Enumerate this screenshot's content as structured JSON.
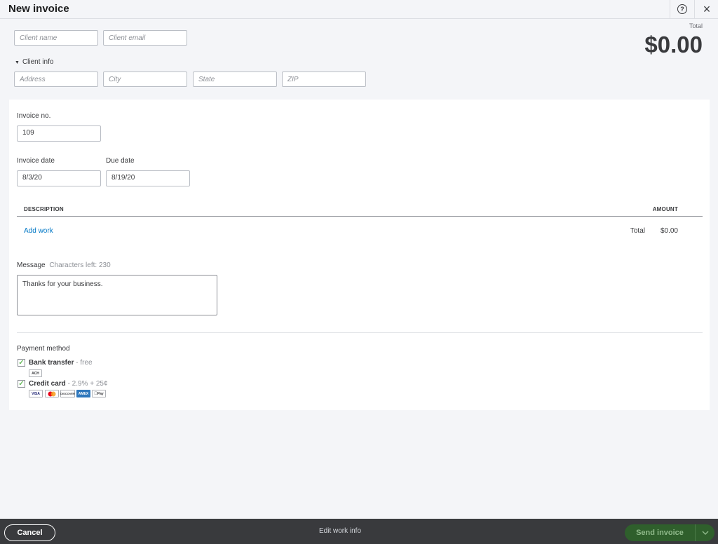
{
  "header": {
    "title": "New invoice",
    "help_icon": "help-circle-icon",
    "close_icon": "close-icon",
    "help_glyph": "?",
    "close_glyph": "×"
  },
  "client": {
    "name_placeholder": "Client name",
    "email_placeholder": "Client email",
    "info_toggle": "Client info",
    "address_placeholder": "Address",
    "city_placeholder": "City",
    "state_placeholder": "State",
    "zip_placeholder": "ZIP"
  },
  "summary": {
    "total_label": "Total",
    "total_amount": "$0.00"
  },
  "invoice": {
    "number_label": "Invoice no.",
    "number_value": "109",
    "date_label": "Invoice date",
    "date_value": "8/3/20",
    "due_label": "Due date",
    "due_value": "8/19/20"
  },
  "lines": {
    "description_header": "DESCRIPTION",
    "amount_header": "AMOUNT",
    "add_work": "Add work",
    "total_label": "Total",
    "total_value": "$0.00"
  },
  "message": {
    "label": "Message",
    "chars_left": "Characters left: 230",
    "value": "Thanks for your business."
  },
  "payment": {
    "section_label": "Payment method",
    "bank": {
      "label": "Bank transfer",
      "fee": " - free",
      "checked": true,
      "badge": "ACH"
    },
    "card": {
      "label": "Credit card",
      "fee": " - 2.9% + 25¢",
      "checked": true,
      "badges": [
        "VISA",
        "MC",
        "DISCOVER",
        "AMEX",
        "Pay"
      ]
    }
  },
  "footer": {
    "cancel": "Cancel",
    "edit_work": "Edit work info",
    "send": "Send invoice"
  },
  "colors": {
    "accent_green": "#2ca01c",
    "link_blue": "#0077c5",
    "footer_bg": "#393a3d"
  }
}
